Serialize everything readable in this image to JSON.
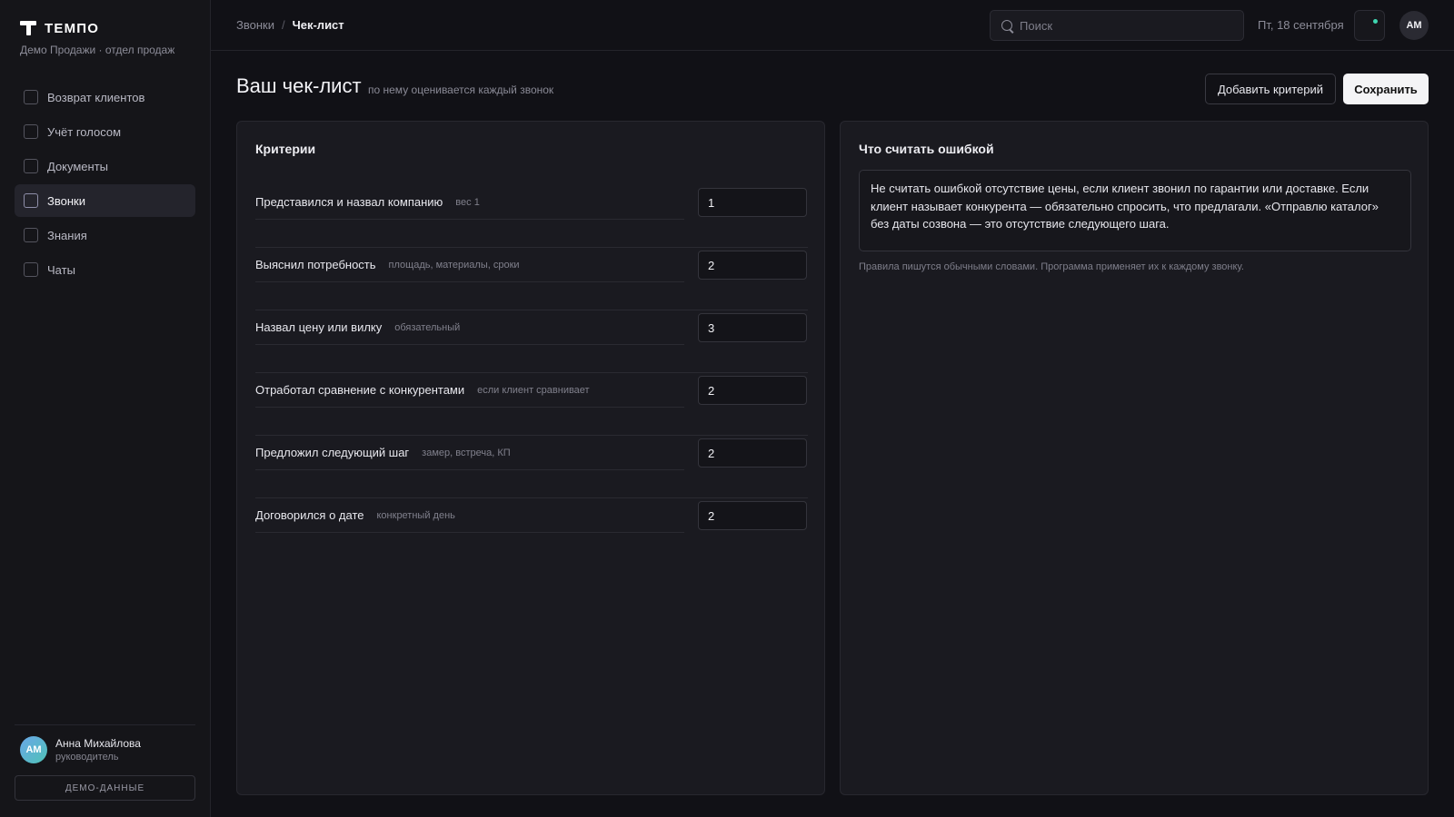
{
  "brand": {
    "name": "ТЕМПО",
    "subtitle": "Демо Продажи · отдел продаж"
  },
  "sidebar": {
    "items": [
      {
        "label": "Возврат клиентов",
        "active": false
      },
      {
        "label": "Учёт голосом",
        "active": false
      },
      {
        "label": "Документы",
        "active": false
      },
      {
        "label": "Звонки",
        "active": true
      },
      {
        "label": "Знания",
        "active": false
      },
      {
        "label": "Чаты",
        "active": false
      }
    ],
    "user": {
      "initials": "АМ",
      "name": "Анна Михайлова",
      "role": "руководитель"
    },
    "demo_label": "ДЕМО-ДАННЫЕ"
  },
  "header": {
    "breadcrumb": [
      "Звонки",
      "Чек-лист"
    ],
    "breadcrumb_sep": "/",
    "search_placeholder": "Поиск",
    "date": "Пт, 18 сентября",
    "avatar_initials": "АМ"
  },
  "page": {
    "title": "Ваш чек-лист",
    "subtitle": "по нему оценивается каждый звонок",
    "add_label": "Добавить критерий",
    "save_label": "Сохранить"
  },
  "criteria": {
    "title": "Критерии",
    "items": [
      {
        "name": "Представился и назвал компанию",
        "hint": "вес 1",
        "weight": "1"
      },
      {
        "name": "Выяснил потребность",
        "hint": "площадь, материалы, сроки",
        "weight": "2"
      },
      {
        "name": "Назвал цену или вилку",
        "hint": "обязательный",
        "weight": "3"
      },
      {
        "name": "Отработал сравнение с конкурентами",
        "hint": "если клиент сравнивает",
        "weight": "2"
      },
      {
        "name": "Предложил следующий шаг",
        "hint": "замер, встреча, КП",
        "weight": "2"
      },
      {
        "name": "Договорился о дате",
        "hint": "конкретный день",
        "weight": "2"
      }
    ]
  },
  "rules": {
    "title": "Что считать ошибкой",
    "text": "Не считать ошибкой отсутствие цены, если клиент звонил по гарантии или доставке. Если клиент называет конкурента — обязательно спросить, что предлагали. «Отправлю каталог» без даты созвона — это отсутствие следующего шага.",
    "note": "Правила пишутся обычными словами. Программа применяет их к каждому звонку."
  }
}
